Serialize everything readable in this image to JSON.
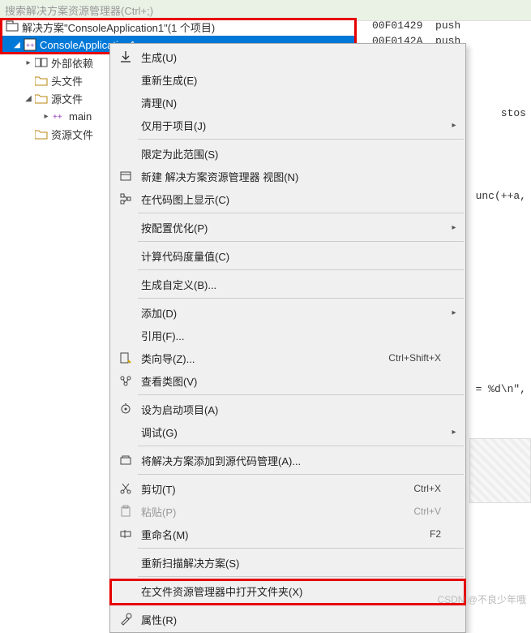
{
  "topBar": "搜索解决方案资源管理器(Ctrl+;)",
  "tree": {
    "solution": "解决方案\"ConsoleApplication1\"(1 个项目)",
    "project": "ConsoleApplication1",
    "externalDeps": "外部依赖",
    "headers": "头文件",
    "sources": "源文件",
    "main": "main",
    "resources": "资源文件"
  },
  "asm": {
    "l1a": "00F01429",
    "l1b": "push",
    "l2a": "00F0142A",
    "l2b": "push"
  },
  "frag": {
    "stos": "stos",
    "func": "unc(++a,",
    "fmt": "= %d\\n\","
  },
  "menu": {
    "build": "生成(U)",
    "rebuild": "重新生成(E)",
    "clean": "清理(N)",
    "projectOnly": "仅用于项目(J)",
    "scope": "限定为此范围(S)",
    "newView": "新建 解决方案资源管理器 视图(N)",
    "codeMap": "在代码图上显示(C)",
    "profile": "按配置优化(P)",
    "metrics": "计算代码度量值(C)",
    "buildCustom": "生成自定义(B)...",
    "add": "添加(D)",
    "references": "引用(F)...",
    "classWizard": "类向导(Z)...",
    "classWizardKey": "Ctrl+Shift+X",
    "classView": "查看类图(V)",
    "startup": "设为启动项目(A)",
    "debug": "调试(G)",
    "sourceControl": "将解决方案添加到源代码管理(A)...",
    "cut": "剪切(T)",
    "cutKey": "Ctrl+X",
    "paste": "粘贴(P)",
    "pasteKey": "Ctrl+V",
    "rename": "重命名(M)",
    "renameKey": "F2",
    "rescan": "重新扫描解决方案(S)",
    "openFolder": "在文件资源管理器中打开文件夹(X)",
    "properties": "属性(R)"
  },
  "watermark": "CSDN @不良少年哦"
}
